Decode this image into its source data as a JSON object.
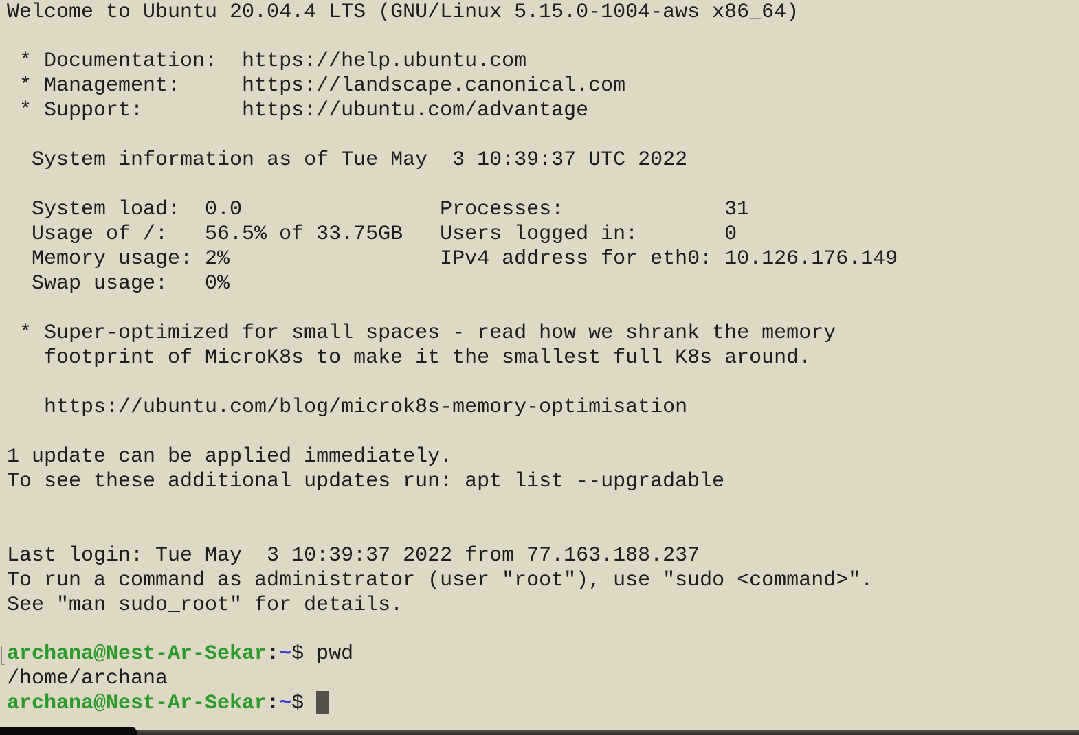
{
  "terminal": {
    "welcome": "Welcome to Ubuntu 20.04.4 LTS (GNU/Linux 5.15.0-1004-aws x86_64)",
    "links": [
      " * Documentation:  https://help.ubuntu.com",
      " * Management:     https://landscape.canonical.com",
      " * Support:        https://ubuntu.com/advantage"
    ],
    "sysinfo_header": "  System information as of Tue May  3 10:39:37 UTC 2022",
    "sysinfo_rows": [
      "  System load:  0.0                Processes:             31",
      "  Usage of /:   56.5% of 33.75GB   Users logged in:       0",
      "  Memory usage: 2%                 IPv4 address for eth0: 10.126.176.149",
      "  Swap usage:   0%"
    ],
    "promo": [
      " * Super-optimized for small spaces - read how we shrank the memory",
      "   footprint of MicroK8s to make it the smallest full K8s around.",
      "   https://ubuntu.com/blog/microk8s-memory-optimisation"
    ],
    "updates": [
      "1 update can be applied immediately.",
      "To see these additional updates run: apt list --upgradable"
    ],
    "last_login": "Last login: Tue May  3 10:39:37 2022 from 77.163.188.237",
    "sudo_notice": [
      "To run a command as administrator (user \"root\"), use \"sudo <command>\".",
      "See \"man sudo_root\" for details."
    ],
    "prompt_user_host": "archana@Nest-Ar-Sekar",
    "prompt_colon": ":",
    "prompt_path": "~",
    "prompt_symbol": "$ ",
    "command_1": "pwd",
    "output_1": "/home/archana"
  }
}
